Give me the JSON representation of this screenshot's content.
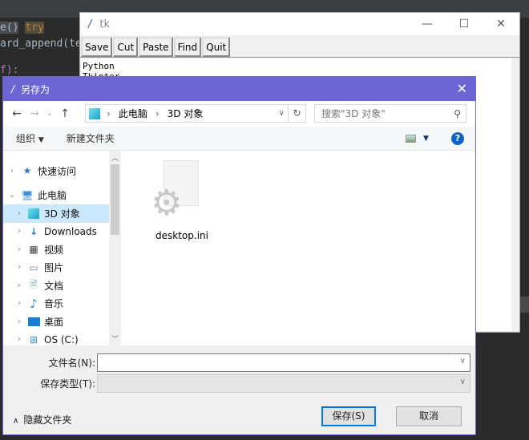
{
  "editor": {
    "lines": [
      "e()",
      "try",
      "ard_append(te",
      "f):"
    ]
  },
  "tk": {
    "title": "tk",
    "buttons": [
      "Save",
      "Cut",
      "Paste",
      "Find",
      "Quit"
    ],
    "text_lines": [
      "Python",
      "Tkinter"
    ]
  },
  "dialog": {
    "title": "另存为",
    "path": [
      "此电脑",
      "3D 对象"
    ],
    "search_placeholder": "搜索\"3D 对象\"",
    "organize": "组织",
    "new_folder": "新建文件夹",
    "tree": [
      {
        "label": "快速访问",
        "icon": "star-icon"
      },
      {
        "label": "此电脑",
        "icon": "computer-icon",
        "expanded": true
      },
      {
        "label": "3D 对象",
        "icon": "cube-icon",
        "selected": true
      },
      {
        "label": "Downloads",
        "icon": "download-icon"
      },
      {
        "label": "视频",
        "icon": "video-icon"
      },
      {
        "label": "图片",
        "icon": "picture-icon"
      },
      {
        "label": "文档",
        "icon": "document-icon"
      },
      {
        "label": "音乐",
        "icon": "music-icon"
      },
      {
        "label": "桌面",
        "icon": "desktop-icon"
      },
      {
        "label": "OS (C:)",
        "icon": "drive-icon"
      }
    ],
    "files": [
      {
        "name": "desktop.ini",
        "icon": "settings-file-icon"
      }
    ],
    "filename_label": "文件名(N):",
    "filename_value": "",
    "filetype_label": "保存类型(T):",
    "filetype_value": "",
    "hide_folders": "隐藏文件夹",
    "save": "保存(S)",
    "cancel": "取消",
    "accent": "#6b66d3"
  }
}
